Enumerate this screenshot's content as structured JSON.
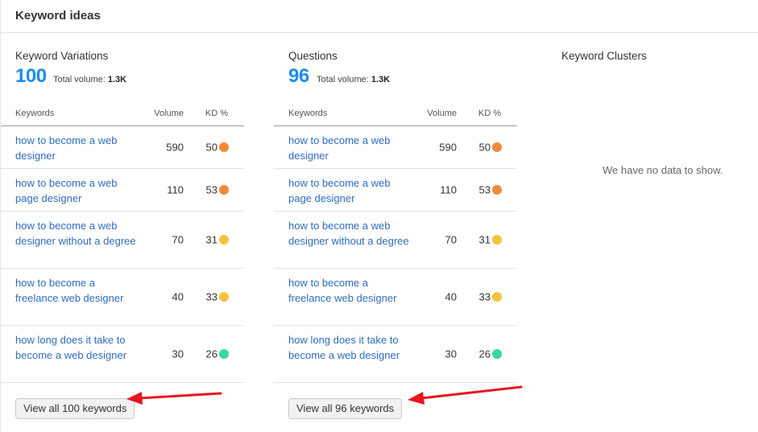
{
  "card": {
    "title": "Keyword ideas"
  },
  "variations": {
    "title": "Keyword Variations",
    "count": "100",
    "total_volume_label": "Total volume:",
    "total_volume": "1.3K",
    "headers": {
      "keyword": "Keywords",
      "volume": "Volume",
      "kd": "KD %"
    },
    "rows": [
      {
        "keyword": "how to become a web designer",
        "volume": "590",
        "kd": "50",
        "kd_color": "#f28a3a"
      },
      {
        "keyword": "how to become a web page designer",
        "volume": "110",
        "kd": "53",
        "kd_color": "#f28a3a"
      },
      {
        "keyword": "how to become a web designer without a degree",
        "volume": "70",
        "kd": "31",
        "kd_color": "#f5c33b"
      },
      {
        "keyword": "how to become a freelance web designer",
        "volume": "40",
        "kd": "33",
        "kd_color": "#f5c33b"
      },
      {
        "keyword": "how long does it take to become a web designer",
        "volume": "30",
        "kd": "26",
        "kd_color": "#3ad8a0"
      }
    ],
    "view_all": "View all 100 keywords"
  },
  "questions": {
    "title": "Questions",
    "count": "96",
    "total_volume_label": "Total volume:",
    "total_volume": "1.3K",
    "headers": {
      "keyword": "Keywords",
      "volume": "Volume",
      "kd": "KD %"
    },
    "rows": [
      {
        "keyword": "how to become a web designer",
        "volume": "590",
        "kd": "50",
        "kd_color": "#f28a3a"
      },
      {
        "keyword": "how to become a web page designer",
        "volume": "110",
        "kd": "53",
        "kd_color": "#f28a3a"
      },
      {
        "keyword": "how to become a web designer without a degree",
        "volume": "70",
        "kd": "31",
        "kd_color": "#f5c33b"
      },
      {
        "keyword": "how to become a freelance web designer",
        "volume": "40",
        "kd": "33",
        "kd_color": "#f5c33b"
      },
      {
        "keyword": "how long does it take to become a web designer",
        "volume": "30",
        "kd": "26",
        "kd_color": "#3ad8a0"
      }
    ],
    "view_all": "View all 96 keywords"
  },
  "clusters": {
    "title": "Keyword Clusters",
    "empty_message": "We have no data to show."
  },
  "colors": {
    "accent": "#1a8cf0",
    "link": "#2f6cbd",
    "annotation_arrow": "#e8141c"
  }
}
